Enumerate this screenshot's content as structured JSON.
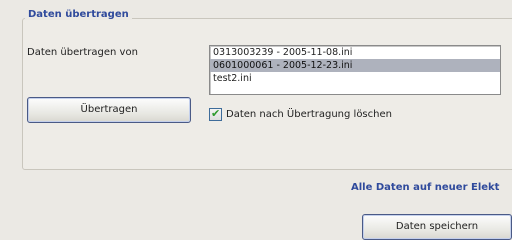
{
  "group": {
    "title": "Daten übertragen",
    "source_label": "Daten übertragen von",
    "files": [
      "0313003239 - 2005-11-08.ini",
      "0601000061 - 2005-12-23.ini",
      "test2.ini"
    ],
    "selected_index": 1,
    "transfer_button": "Übertragen",
    "delete_checkbox_label": "Daten nach Übertragung löschen",
    "delete_checked": true
  },
  "lower": {
    "title": "Alle Daten auf neuer Elekt",
    "save_button": "Daten speichern"
  }
}
